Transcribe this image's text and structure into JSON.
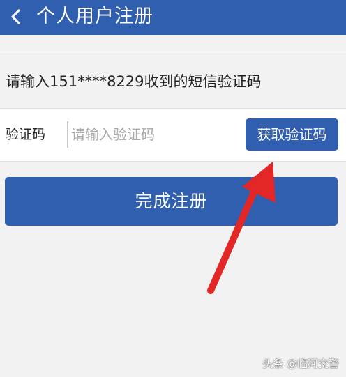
{
  "header": {
    "back_icon": "chevron-left-icon",
    "title": "个人用户注册"
  },
  "hint": "请输入151****8229收到的短信验证码",
  "code_row": {
    "label": "验证码",
    "input_value": "",
    "placeholder": "请输入验证码",
    "get_code_label": "获取验证码"
  },
  "finish_label": "完成注册",
  "watermark": "头条 @临河交警",
  "colors": {
    "primary": "#2f5fae",
    "background": "#f2f2f2",
    "arrow": "#e32626"
  }
}
